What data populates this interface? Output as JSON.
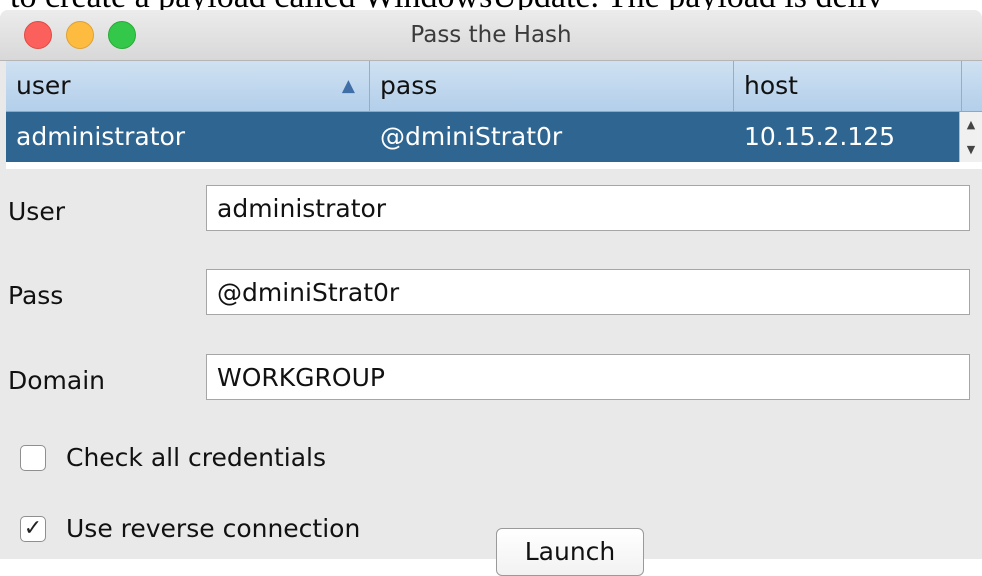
{
  "background_text": "to create a payload called WindowsUpdate. The payload is deliv",
  "window": {
    "title": "Pass the Hash"
  },
  "table": {
    "columns": [
      "user",
      "pass",
      "host"
    ],
    "sorted_column": "user",
    "rows": [
      {
        "user": "administrator",
        "pass": "@dminiStrat0r",
        "host": "10.15.2.125"
      }
    ]
  },
  "form": {
    "user_label": "User",
    "user_value": "administrator",
    "pass_label": "Pass",
    "pass_value": "@dminiStrat0r",
    "domain_label": "Domain",
    "domain_value": "WORKGROUP"
  },
  "options": {
    "check_all_label": "Check all credentials",
    "check_all_checked": false,
    "reverse_label": "Use reverse connection",
    "reverse_checked": true
  },
  "buttons": {
    "launch_label": "Launch"
  }
}
